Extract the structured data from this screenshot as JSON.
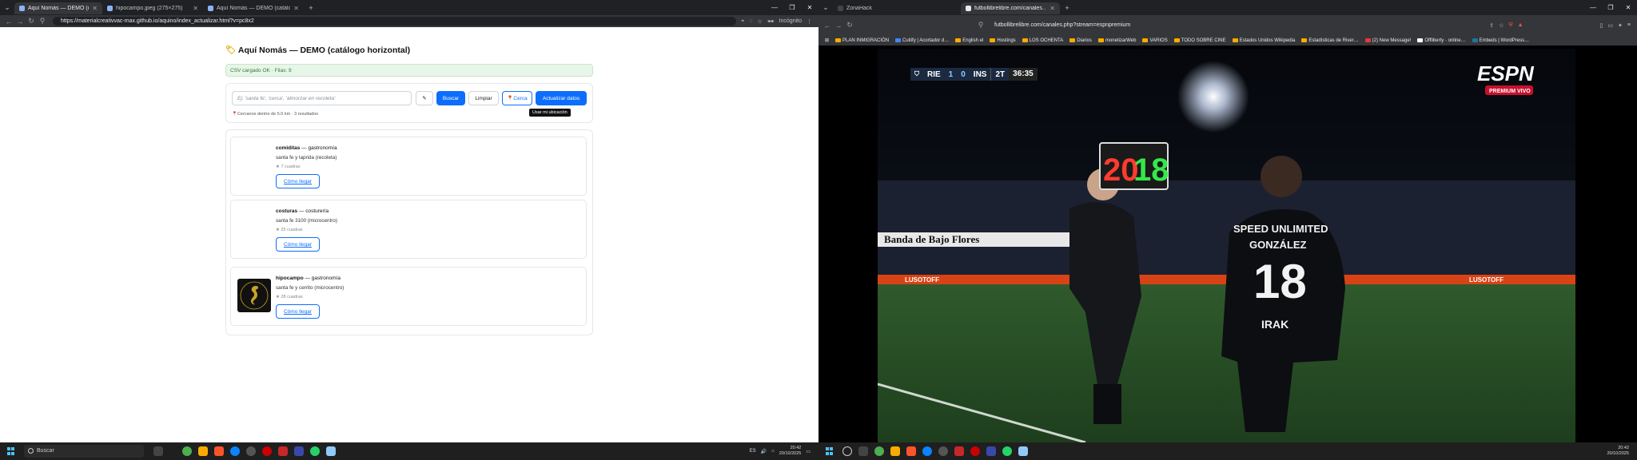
{
  "left_browser": {
    "tabs": [
      {
        "label": "Aquí Nomás — DEMO (catálo…",
        "active": true
      },
      {
        "label": "hipocampo.jpeg (275×275)",
        "active": false
      },
      {
        "label": "Aquí Nomás — DEMO (catálo…",
        "active": false
      }
    ],
    "url": "https://materialcreativvac-max.github.io/aquino/index_actualizar.html?v=pc8x2",
    "incognito": "Incógnito",
    "page": {
      "title": "Aquí Nomás — DEMO (catálogo horizontal)",
      "status": "CSV cargado OK · Filas: 9",
      "search_placeholder": "Ej: 'santa fe', 'cerca', 'almorzar en recoleta'",
      "btn_search": "Buscar",
      "btn_clear": "Limpiar",
      "btn_near": "Cerca",
      "btn_update": "Actualizar datos",
      "tooltip": "Usar mi ubicación",
      "note": "Cercanos dentro de 5.0 km · 3 resultados",
      "items": [
        {
          "name": "comiditas",
          "category": "gastronomía",
          "address": "santa fe y laprida (recoleta)",
          "reviews": "★ 7 cuadras",
          "link": "Cómo llegar",
          "has_logo": false
        },
        {
          "name": "costuras",
          "category": "costurería",
          "address": "santa fe 3100 (microcentro)",
          "reviews": "★ 25 cuadras",
          "link": "Cómo llegar",
          "has_logo": false
        },
        {
          "name": "hipocampo",
          "category": "gastronomía",
          "address": "santa fe y cerrito (microcentro)",
          "reviews": "★ 28 cuadras",
          "link": "Cómo llegar",
          "has_logo": true
        }
      ]
    }
  },
  "right_browser": {
    "tabs": [
      {
        "label": "ZonaHack",
        "active": false
      },
      {
        "label": "futbollibrelibre.com/canales…",
        "active": true
      }
    ],
    "url": "futbollibrelibre.com/canales.php?stream=espnpremium",
    "bookmarks": [
      "PLAN INMIGRACIÓN",
      "Cuitify | Acortador d…",
      "English el",
      "Hostings",
      "LOS OCHENTA",
      "Diarios",
      "monetizarWeb",
      "VARIOS",
      "TODO SOBRE CINE",
      "Estados Unidos Wikipedia",
      "Estadísticas de River…",
      "(2) New Message!",
      "Offliberty · online…",
      "Embeds | WordPress…"
    ],
    "scoreboard": {
      "home": "RIE",
      "home_score": "1",
      "away_score": "0",
      "away": "INS",
      "period": "2T",
      "clock": "36:35"
    },
    "broadcaster": "ESPN",
    "broadcaster_sub": "PREMIUM VIVO",
    "board_out": "20",
    "board_in": "18",
    "banner": "Banda de Bajo Flores",
    "sponsor": "LUSOTOFF",
    "player_sponsor": "SPEED UNLIMITED",
    "player_name": "GONZÁLEZ",
    "player_number": "18",
    "player_name2": "IRAK"
  },
  "taskbar_left": {
    "search": "Buscar",
    "lang": "ES",
    "time": "20:42",
    "date": "20/10/2025"
  },
  "taskbar_right": {
    "time": "20:42",
    "date": "20/10/2025"
  }
}
